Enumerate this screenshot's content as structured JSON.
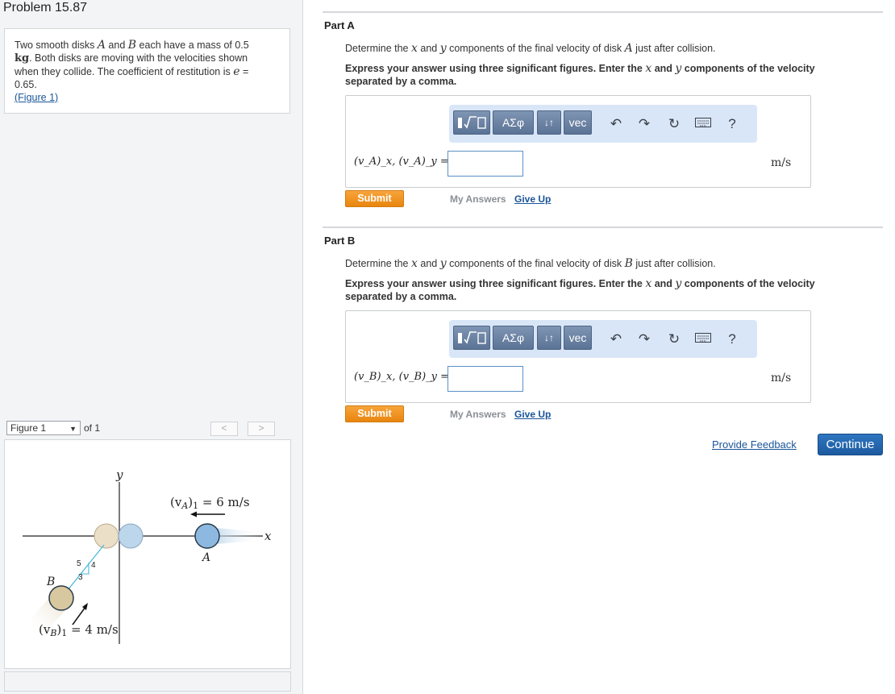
{
  "problem": {
    "title": "Problem 15.87",
    "text": {
      "t1": "Two smooth disks ",
      "a": "A",
      "t2": " and ",
      "b": "B",
      "t3": " each have a mass of 0.5",
      "kg": "kg",
      "t4": ". Both disks are moving with the velocities shown",
      "t5": "when they collide. The coefficient of restitution is ",
      "e": "e",
      "t6": " =",
      "t7": "0.65.",
      "figure_link": "(Figure 1)"
    }
  },
  "figure_nav": {
    "selected": "Figure 1",
    "of_text": "of 1",
    "prev_icon": "<",
    "next_icon": ">"
  },
  "figure": {
    "y_label": "y",
    "x_label": "x",
    "vA_label": "(v",
    "vA_sub": "A",
    "vA_rest": ")",
    "vA_sub1": "1",
    "vA_value": " = 6 m/s",
    "A_label": "A",
    "B_label": "B",
    "vB_label": "(v",
    "vB_sub": "B",
    "vB_rest": ")",
    "vB_sub1": "1",
    "vB_value": " = 4 m/s",
    "tri_5": "5",
    "tri_4": "4",
    "tri_3": "3",
    "colors": {
      "diskA": "#8db8e0",
      "diskA_stroke": "#2a3a4a",
      "diskB": "#d8c8a0",
      "ghost_tan": "#e8dcc4",
      "ghost_blue": "#b8d4ec",
      "line": "#4cb8d8"
    }
  },
  "partA": {
    "label": "Part A",
    "q1": "Determine the ",
    "x": "x",
    "q2": " and ",
    "y": "y",
    "q3": " components of the final velocity of disk ",
    "disk": "A",
    "q4": " just after collision.",
    "instr1": "Express your answer using three significant figures. Enter the ",
    "instr2": " and ",
    "instr3": " components of the velocity",
    "instr4": "separated by a comma.",
    "answer_label": "(v_A)_x, (v_A)_y =",
    "unit": "m/s",
    "submit": "Submit",
    "my_answers": "My Answers",
    "give_up": "Give Up"
  },
  "partB": {
    "label": "Part B",
    "q1": "Determine the ",
    "x": "x",
    "q2": " and ",
    "y": "y",
    "q3": " components of the final velocity of disk ",
    "disk": "B",
    "q4": " just after collision.",
    "instr1": "Express your answer using three significant figures. Enter the ",
    "instr2": " and ",
    "instr3": " components of the velocity",
    "instr4": "separated by a comma.",
    "answer_label": "(v_B)_x, (v_B)_y =",
    "unit": "m/s",
    "submit": "Submit",
    "my_answers": "My Answers",
    "give_up": "Give Up"
  },
  "toolbar": {
    "greek": "ΑΣφ",
    "arrows": "↓↑",
    "vec": "vec",
    "help": "?"
  },
  "footer": {
    "feedback": "Provide Feedback",
    "continue": "Continue"
  }
}
